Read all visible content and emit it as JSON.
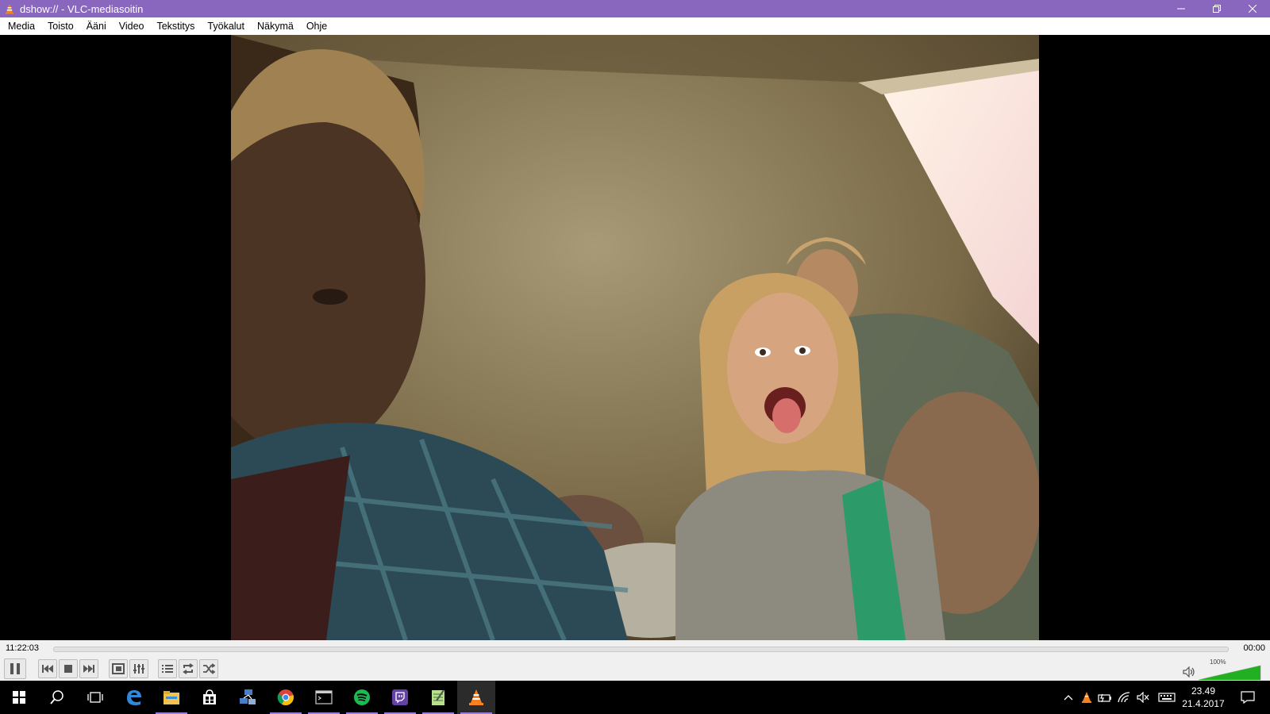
{
  "window": {
    "title": "dshow:// - VLC-mediasoitin",
    "icon": "vlc-cone-icon",
    "title_bar_color": "#8a67bf"
  },
  "menu": [
    {
      "label": "Media"
    },
    {
      "label": "Toisto"
    },
    {
      "label": "Ääni"
    },
    {
      "label": "Video"
    },
    {
      "label": "Tekstitys"
    },
    {
      "label": "Työkalut"
    },
    {
      "label": "Näkymä"
    },
    {
      "label": "Ohje"
    }
  ],
  "video": {
    "content": "webcam-feed"
  },
  "playback": {
    "elapsed": "11:22:03",
    "total": "00:00",
    "progress": 0
  },
  "controls": {
    "buttons": [
      "pause-icon",
      "previous-icon",
      "stop-icon",
      "next-icon",
      "fullscreen-icon",
      "extended-settings-icon",
      "playlist-icon",
      "loop-icon",
      "shuffle-icon"
    ]
  },
  "volume": {
    "label": "100%",
    "level": 1.0,
    "color": "#22b022"
  },
  "taskbar": {
    "apps": [
      "start-icon",
      "search-icon",
      "task-view-icon",
      "edge-icon",
      "file-explorer-icon",
      "store-icon",
      "network-app-icon",
      "chrome-icon",
      "terminal-icon",
      "spotify-icon",
      "twitch-icon",
      "notepad-icon",
      "vlc-icon"
    ],
    "active_app": "vlc-icon"
  },
  "tray": {
    "icons": [
      "show-hidden-icons-chevron",
      "vlc-tray-icon",
      "battery-icon",
      "wifi-icon",
      "speaker-muted-icon",
      "keyboard-icon",
      "action-center-icon"
    ],
    "time": "23.49",
    "date": "21.4.2017"
  }
}
